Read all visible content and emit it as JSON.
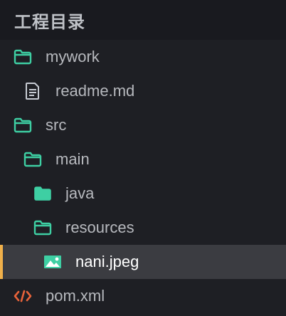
{
  "header": {
    "title": "工程目录"
  },
  "colors": {
    "folder": "#3ecfa3",
    "file_doc": "#c7cbd3",
    "code": "#e8633a",
    "selected_accent": "#f0b04a"
  },
  "tree": {
    "items": [
      {
        "label": "mywork",
        "icon": "folder-outline-icon"
      },
      {
        "label": "readme.md",
        "icon": "document-icon"
      },
      {
        "label": "src",
        "icon": "folder-outline-icon"
      },
      {
        "label": "main",
        "icon": "folder-outline-icon"
      },
      {
        "label": "java",
        "icon": "folder-filled-icon"
      },
      {
        "label": "resources",
        "icon": "folder-outline-icon"
      },
      {
        "label": "nani.jpeg",
        "icon": "image-icon",
        "selected": true
      },
      {
        "label": "pom.xml",
        "icon": "code-icon"
      }
    ]
  }
}
